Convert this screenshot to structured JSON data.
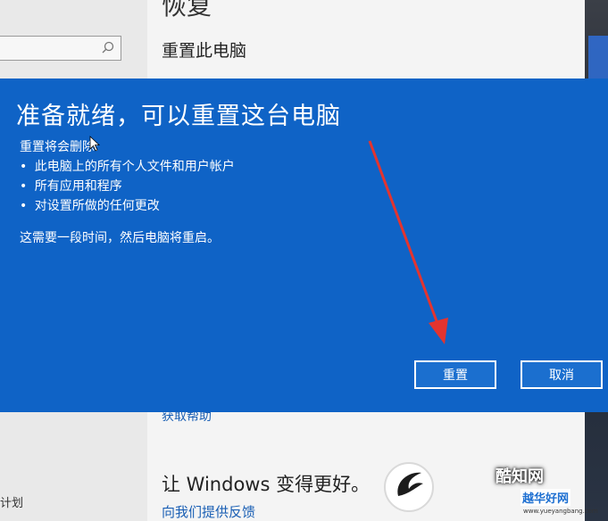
{
  "settings": {
    "recovery_title": "恢复",
    "reset_pc_heading": "重置此电脑",
    "help_link": "获取帮助",
    "better_windows": "让 Windows 变得更好。",
    "feedback_link": "向我们提供反馈",
    "left_plan_text": "计划"
  },
  "dialog": {
    "title": "准备就绪，可以重置这台电脑",
    "subtitle": "重置将会删除:",
    "items": [
      "此电脑上的所有个人文件和用户帐户",
      "所有应用和程序",
      "对设置所做的任何更改"
    ],
    "note": "这需要一段时间，然后电脑将重启。",
    "reset_label": "重置",
    "cancel_label": "取消"
  },
  "watermark": {
    "brand": "酷知网",
    "sub": "越华好网",
    "url": "www.yueyangbang.com"
  },
  "colors": {
    "dialog_blue": "#0f63c6",
    "annotation_red": "#e3342f"
  },
  "icons": {
    "search": "search-icon",
    "cursor": "cursor-icon",
    "arrow": "red-arrow-icon",
    "logo": "watermark-logo-icon"
  }
}
